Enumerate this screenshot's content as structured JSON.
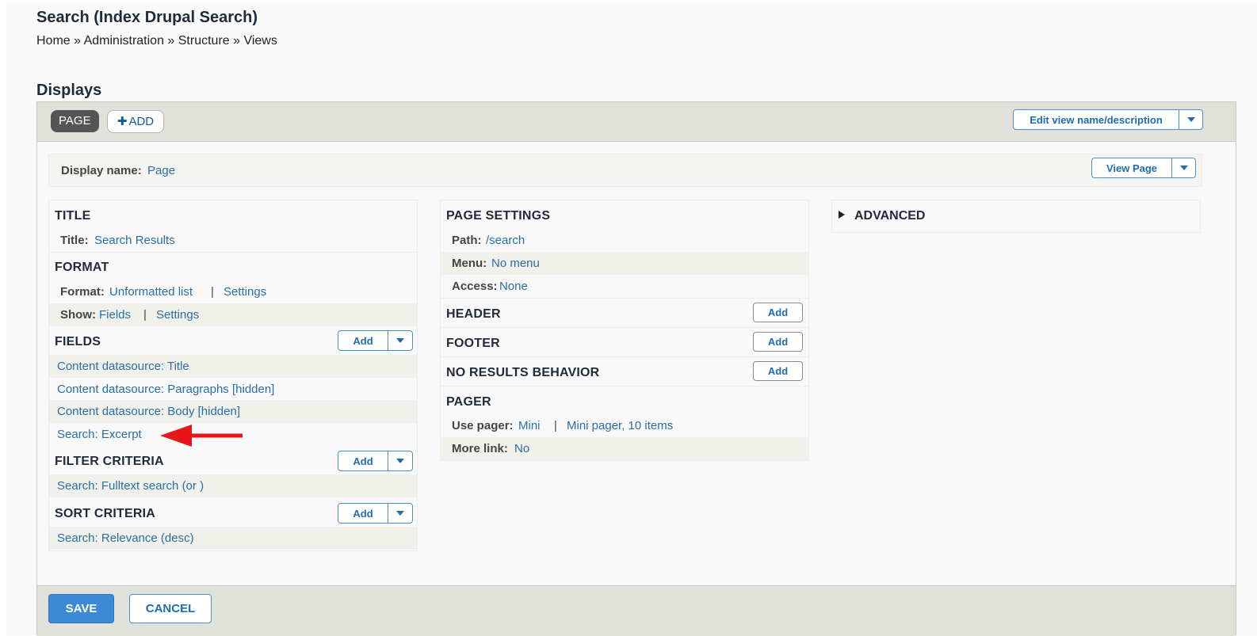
{
  "page": {
    "title": "Search (Index Drupal Search)",
    "breadcrumb": "Home » Administration » Structure » Views"
  },
  "displays": {
    "heading": "Displays",
    "tab_page": "PAGE",
    "tab_add_icon": "plus-icon",
    "tab_add": "ADD",
    "edit_view": "Edit view name/description",
    "display_name_label": "Display name:",
    "display_name_value": "Page",
    "view_page": "View Page"
  },
  "col1": {
    "title": {
      "heading": "TITLE",
      "label": "Title:",
      "value": "Search Results"
    },
    "format": {
      "heading": "FORMAT",
      "format_label": "Format:",
      "format_value": "Unformatted list",
      "format_settings": "Settings",
      "show_label": "Show:",
      "show_value": "Fields",
      "show_settings": "Settings"
    },
    "fields": {
      "heading": "FIELDS",
      "add": "Add",
      "items": [
        "Content datasource: Title",
        "Content datasource: Paragraphs [hidden]",
        "Content datasource: Body [hidden]",
        "Search: Excerpt"
      ]
    },
    "filter": {
      "heading": "FILTER CRITERIA",
      "add": "Add",
      "items": [
        "Search: Fulltext search (or )"
      ]
    },
    "sort": {
      "heading": "SORT CRITERIA",
      "add": "Add",
      "items": [
        "Search: Relevance (desc)"
      ]
    }
  },
  "col2": {
    "page_settings": {
      "heading": "PAGE SETTINGS",
      "path_label": "Path:",
      "path_value": "/search",
      "menu_label": "Menu:",
      "menu_value": "No menu",
      "access_label": "Access:",
      "access_value": "None"
    },
    "header": {
      "heading": "HEADER",
      "add": "Add"
    },
    "footer": {
      "heading": "FOOTER",
      "add": "Add"
    },
    "no_results": {
      "heading": "NO RESULTS BEHAVIOR",
      "add": "Add"
    },
    "pager": {
      "heading": "PAGER",
      "use_pager_label": "Use pager:",
      "use_pager_value": "Mini",
      "pager_detail": "Mini pager, 10 items",
      "more_link_label": "More link:",
      "more_link_value": "No"
    }
  },
  "col3": {
    "advanced": "ADVANCED"
  },
  "actions": {
    "save": "SAVE",
    "cancel": "CANCEL"
  },
  "colors": {
    "link": "#2a6ea6",
    "annotation_arrow": "#e8161b",
    "primary_button": "#3c8ad6"
  }
}
